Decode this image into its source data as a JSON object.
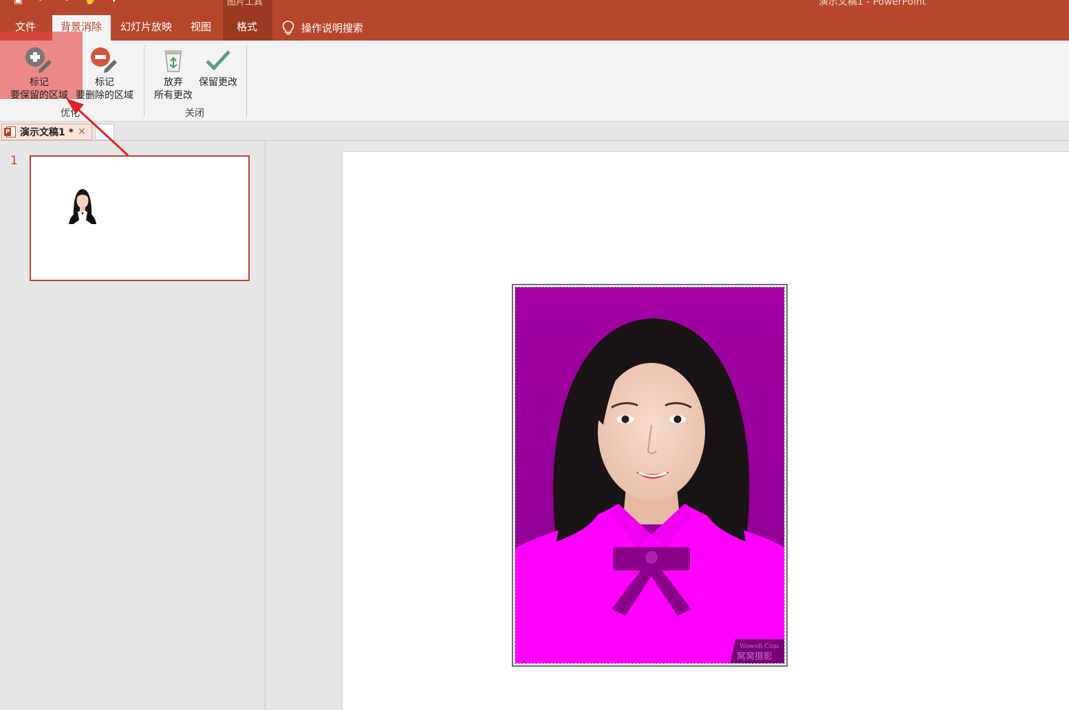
{
  "titlebar": {
    "context_group_label": "图片工具",
    "window_title": "演示文稿1  -  PowerPoint"
  },
  "tabs": [
    {
      "label": "文件"
    },
    {
      "label": "背景消除"
    },
    {
      "label": "幻灯片放映"
    },
    {
      "label": "视图"
    },
    {
      "label": "格式"
    }
  ],
  "search": {
    "label": "操作说明搜索"
  },
  "ribbon": {
    "mark_keep": {
      "line1": "标记",
      "line2": "要保留的区域"
    },
    "mark_remove": {
      "line1": "标记",
      "line2": "要删除的区域"
    },
    "discard": {
      "line1": "放弃",
      "line2": "所有更改"
    },
    "keep_changes": {
      "label": "保留更改"
    },
    "group_refine": "优化",
    "group_close": "关闭"
  },
  "document_tab": {
    "label": "演示文稿1 *"
  },
  "slides": [
    {
      "number": "1"
    }
  ],
  "colors": {
    "accent": "#b7472a",
    "removal_overlay": "#a300a3",
    "garment_overlay": "#ff00ff",
    "annotation": "#e0202a"
  },
  "watermark": {
    "line1": "Wowofi.Com",
    "line2": "窝窝摄影"
  }
}
